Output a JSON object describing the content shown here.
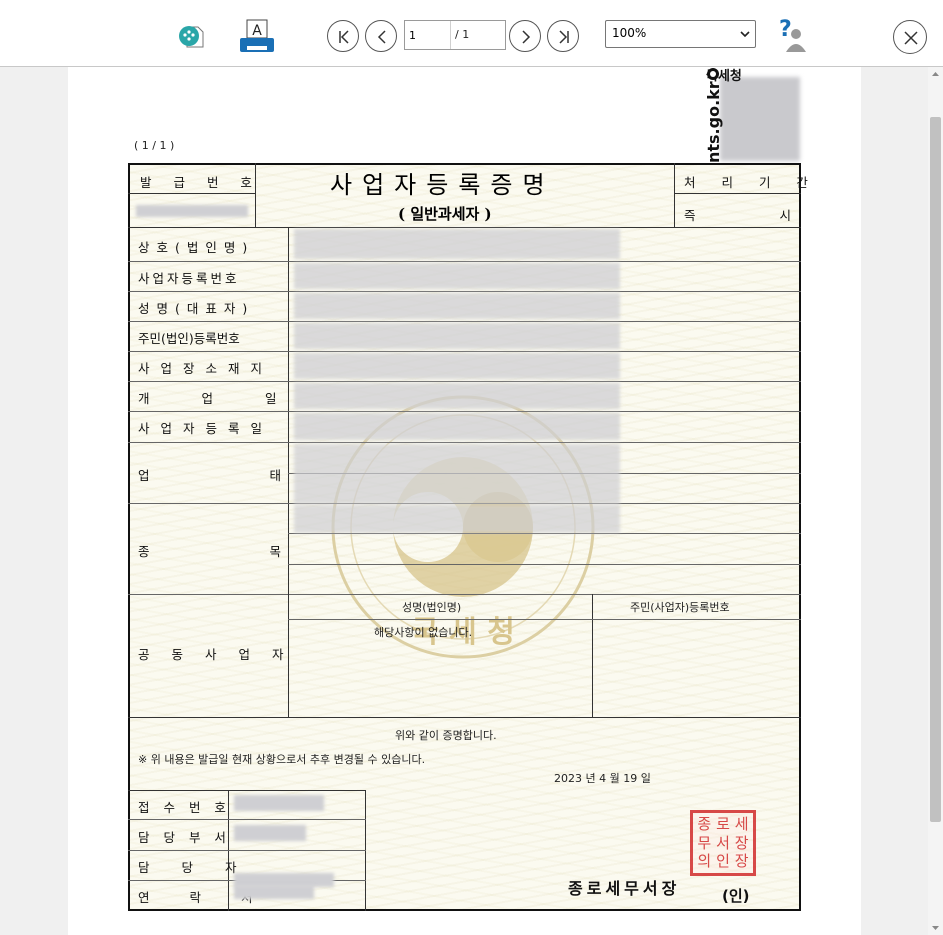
{
  "toolbar": {
    "icons": {
      "save": "save-file-icon",
      "print": "printer-icon",
      "help": "help-icon"
    },
    "nav": {
      "first": "first-page-icon",
      "prev": "previous-page-icon",
      "next": "next-page-icon",
      "last": "last-page-icon"
    },
    "current_page": "1",
    "total_pages": "/ 1",
    "zoom": "100%",
    "close": "close-icon",
    "print_letter": "A",
    "help_glyph": "?"
  },
  "document": {
    "page_counter": "(   1 / 1   )",
    "logo_agency": "국세청",
    "logo_url": "nts.go.kr",
    "title": "사업자등록증명",
    "subtitle": "( 일반과세자 )",
    "issue_no_label": "발 급 번 호",
    "processing_period_label": "처 리 기 간",
    "processing_period_value": "즉 시",
    "fields": [
      {
        "label": "상호(법인명)"
      },
      {
        "label": "사업자등록번호"
      },
      {
        "label": "성명(대표자)"
      },
      {
        "label": "주민(법인)등록번호"
      },
      {
        "label": "사업장소재지"
      },
      {
        "label": "개업일"
      },
      {
        "label": "사업자등록일"
      },
      {
        "label": "업태"
      },
      {
        "label": "종목"
      }
    ],
    "co_owner_label": "공동사업자",
    "co_owner_col1": "성명(법인명)",
    "co_owner_col2": "주민(사업자)등록번호",
    "co_owner_none": "해당사항이 없습니다.",
    "certify_text": "위와 같이 증명합니다.",
    "notice_text": "※  위 내용은 발급일 현재 상황으로서 추후 변경될 수 있습니다.",
    "date_text": "2023 년  4 월  19 일",
    "receipt_no_label": "접 수 번 호",
    "department_label": "담 당 부 서",
    "person_label": "담 당 자",
    "contact_label": "연 락 처",
    "office_name": "종로세무서장",
    "seal_mark": "(인)",
    "watermark_text": "국 세 청",
    "stamp_chars": [
      "종",
      "로",
      "세",
      "무",
      "서",
      "장",
      "의",
      "인",
      "장"
    ]
  },
  "colors": {
    "stamp_red": "#d12b2b",
    "watermark_gold": "#c9b57a",
    "nts_blue": "#1a6fb5",
    "teal_icon": "#2aa6a8"
  }
}
